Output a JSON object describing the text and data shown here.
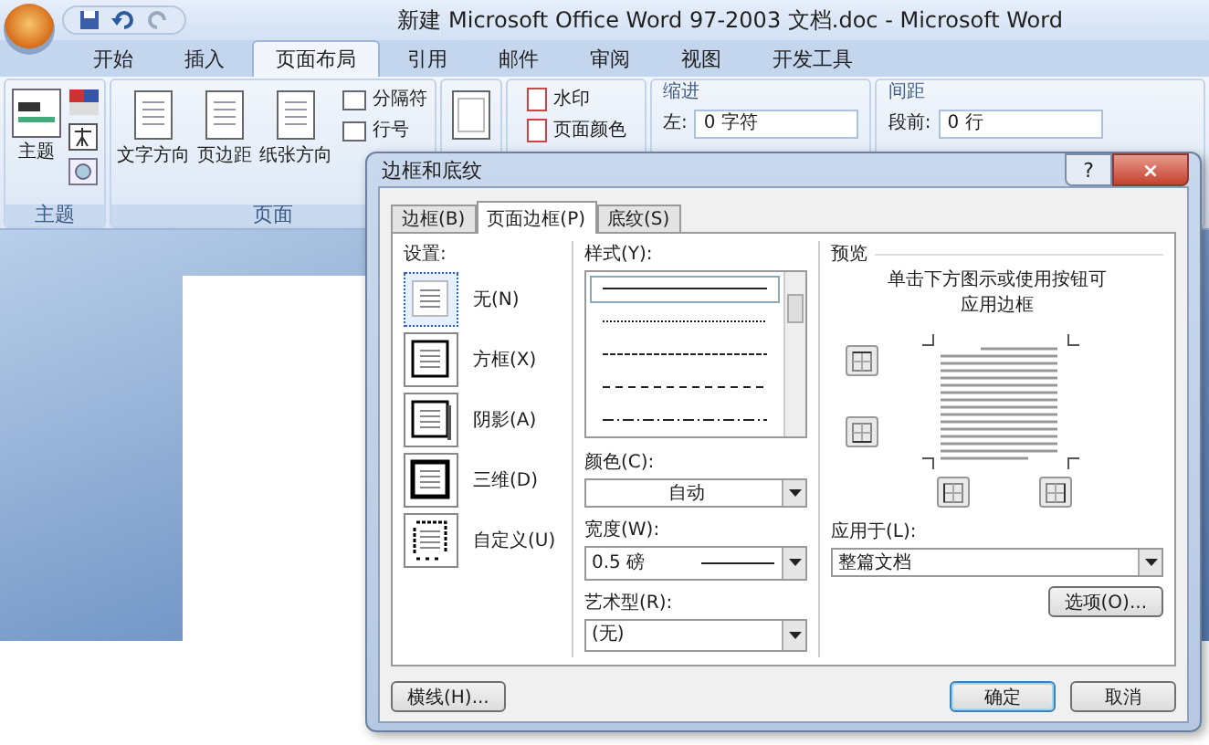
{
  "window": {
    "title": "新建 Microsoft Office Word 97-2003 文档.doc - Microsoft Word"
  },
  "ribbon": {
    "tabs": [
      {
        "label": "开始",
        "selected": false
      },
      {
        "label": "插入",
        "selected": false
      },
      {
        "label": "页面布局",
        "selected": true
      },
      {
        "label": "引用",
        "selected": false
      },
      {
        "label": "邮件",
        "selected": false
      },
      {
        "label": "审阅",
        "selected": false
      },
      {
        "label": "视图",
        "selected": false
      },
      {
        "label": "开发工具",
        "selected": false
      }
    ],
    "theme_group": {
      "label": "主题",
      "button": "主题"
    },
    "page_group": {
      "label": "页面",
      "buttons": [
        "文字方向",
        "页边距",
        "纸张方向"
      ],
      "small": [
        "分隔符",
        "行号"
      ]
    },
    "background_small": [
      "水印",
      "页面颜色"
    ],
    "indent": {
      "heading": "缩进",
      "label": "左:",
      "value": "0 字符"
    },
    "spacing": {
      "heading": "间距",
      "label": "段前:",
      "value": "0 行"
    }
  },
  "dialog": {
    "title": "边框和底纹",
    "help": "?",
    "close": "×",
    "tabs": [
      {
        "label": "边框(B)",
        "selected": false
      },
      {
        "label": "页面边框(P)",
        "selected": true
      },
      {
        "label": "底纹(S)",
        "selected": false
      }
    ],
    "settings": {
      "label": "设置:",
      "items": [
        {
          "label": "无(N)",
          "kind": "none",
          "selected": true
        },
        {
          "label": "方框(X)",
          "kind": "box",
          "selected": false
        },
        {
          "label": "阴影(A)",
          "kind": "shadow",
          "selected": false
        },
        {
          "label": "三维(D)",
          "kind": "threed",
          "selected": false
        },
        {
          "label": "自定义(U)",
          "kind": "custom",
          "selected": false
        }
      ]
    },
    "style": {
      "label": "样式(Y):",
      "lines": [
        {
          "kind": "solid",
          "selected": true
        },
        {
          "kind": "dotted",
          "selected": false
        },
        {
          "kind": "dashed",
          "selected": false
        },
        {
          "kind": "dash",
          "selected": false
        },
        {
          "kind": "dashdot",
          "selected": false
        }
      ]
    },
    "color": {
      "label": "颜色(C):",
      "value": "自动"
    },
    "width": {
      "label": "宽度(W):",
      "value": "0.5 磅"
    },
    "art": {
      "label": "艺术型(R):",
      "value": "(无)"
    },
    "preview": {
      "label": "预览",
      "hint_lines": [
        "单击下方图示或使用按钮可",
        "应用边框"
      ]
    },
    "apply": {
      "label": "应用于(L):",
      "value": "整篇文档"
    },
    "options_button": "选项(O)...",
    "horizontal_button": "横线(H)...",
    "ok_button": "确定",
    "cancel_button": "取消"
  }
}
